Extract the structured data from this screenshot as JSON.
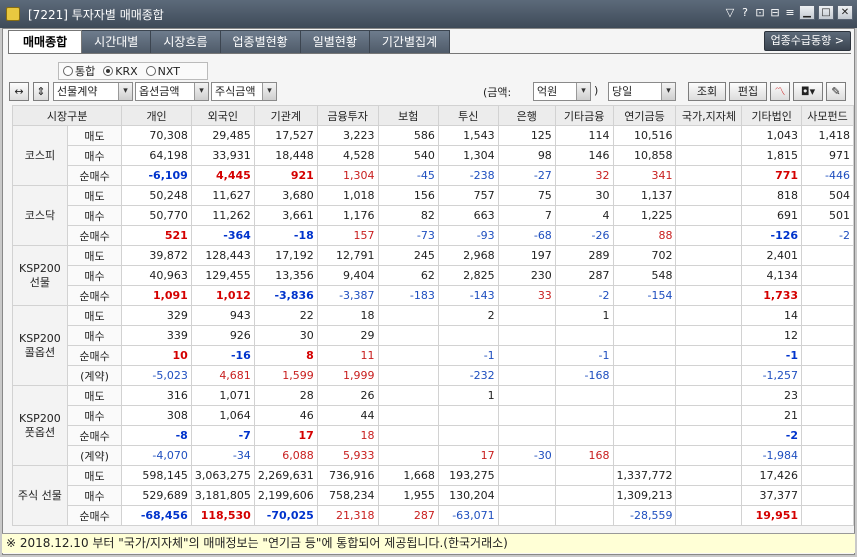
{
  "window": {
    "title": "[7221] 투자자별 매매종합"
  },
  "tabs": [
    "매매종합",
    "시간대별",
    "시장흐름",
    "업종별현황",
    "일별현황",
    "기간별집계"
  ],
  "side_button": "업종수급동향 >",
  "market_radios": [
    "통합",
    "KRX",
    "NXT"
  ],
  "market_selected": "KRX",
  "controls": {
    "product": "선물계약",
    "amount_type": "옵션금액",
    "stock_amount": "주식금액",
    "amount_label_open": "(금액:",
    "unit": "억원",
    "amount_label_close": ")",
    "period": "당일",
    "query_btn": "조회",
    "edit_btn": "편집"
  },
  "headers": [
    "시장구분",
    "",
    "개인",
    "외국인",
    "기관계",
    "금융투자",
    "보험",
    "투신",
    "은행",
    "기타금융",
    "연기금등",
    "국가,지자체",
    "기타법인",
    "사모펀드"
  ],
  "sections": [
    {
      "market": "코스피",
      "rows": [
        {
          "label": "매도",
          "v": [
            "70,308",
            "29,485",
            "17,527",
            "3,223",
            "586",
            "1,543",
            "125",
            "114",
            "10,516",
            "",
            "1,043",
            "1,418"
          ]
        },
        {
          "label": "매수",
          "v": [
            "64,198",
            "33,931",
            "18,448",
            "4,528",
            "540",
            "1,304",
            "98",
            "146",
            "10,858",
            "",
            "1,815",
            "971"
          ]
        },
        {
          "label": "순매수",
          "v": [
            "-6,109",
            "4,445",
            "921",
            "1,304",
            "-45",
            "-238",
            "-27",
            "32",
            "341",
            "",
            "771",
            "-446"
          ]
        }
      ]
    },
    {
      "market": "코스닥",
      "rows": [
        {
          "label": "매도",
          "v": [
            "50,248",
            "11,627",
            "3,680",
            "1,018",
            "156",
            "757",
            "75",
            "30",
            "1,137",
            "",
            "818",
            "504"
          ]
        },
        {
          "label": "매수",
          "v": [
            "50,770",
            "11,262",
            "3,661",
            "1,176",
            "82",
            "663",
            "7",
            "4",
            "1,225",
            "",
            "691",
            "501"
          ]
        },
        {
          "label": "순매수",
          "v": [
            "521",
            "-364",
            "-18",
            "157",
            "-73",
            "-93",
            "-68",
            "-26",
            "88",
            "",
            "-126",
            "-2"
          ]
        }
      ]
    },
    {
      "market": "KSP200 선물",
      "rows": [
        {
          "label": "매도",
          "v": [
            "39,872",
            "128,443",
            "17,192",
            "12,791",
            "245",
            "2,968",
            "197",
            "289",
            "702",
            "",
            "2,401",
            ""
          ]
        },
        {
          "label": "매수",
          "v": [
            "40,963",
            "129,455",
            "13,356",
            "9,404",
            "62",
            "2,825",
            "230",
            "287",
            "548",
            "",
            "4,134",
            ""
          ]
        },
        {
          "label": "순매수",
          "v": [
            "1,091",
            "1,012",
            "-3,836",
            "-3,387",
            "-183",
            "-143",
            "33",
            "-2",
            "-154",
            "",
            "1,733",
            ""
          ]
        }
      ]
    },
    {
      "market": "KSP200 콜옵션",
      "rows": [
        {
          "label": "매도",
          "v": [
            "329",
            "943",
            "22",
            "18",
            "",
            "2",
            "",
            "1",
            "",
            "",
            "14",
            ""
          ]
        },
        {
          "label": "매수",
          "v": [
            "339",
            "926",
            "30",
            "29",
            "",
            "",
            "",
            "",
            "",
            "",
            "12",
            ""
          ]
        },
        {
          "label": "순매수",
          "v": [
            "10",
            "-16",
            "8",
            "11",
            "",
            "-1",
            "",
            "-1",
            "",
            "",
            "-1",
            ""
          ]
        },
        {
          "label": "(계약)",
          "v": [
            "-5,023",
            "4,681",
            "1,599",
            "1,999",
            "",
            "-232",
            "",
            "-168",
            "",
            "",
            "-1,257",
            ""
          ]
        }
      ]
    },
    {
      "market": "KSP200 풋옵션",
      "rows": [
        {
          "label": "매도",
          "v": [
            "316",
            "1,071",
            "28",
            "26",
            "",
            "1",
            "",
            "",
            "",
            "",
            "23",
            ""
          ]
        },
        {
          "label": "매수",
          "v": [
            "308",
            "1,064",
            "46",
            "44",
            "",
            "",
            "",
            "",
            "",
            "",
            "21",
            ""
          ]
        },
        {
          "label": "순매수",
          "v": [
            "-8",
            "-7",
            "17",
            "18",
            "",
            "",
            "",
            "",
            "",
            "",
            "-2",
            ""
          ]
        },
        {
          "label": "(계약)",
          "v": [
            "-4,070",
            "-34",
            "6,088",
            "5,933",
            "",
            "17",
            "-30",
            "168",
            "",
            "",
            "-1,984",
            ""
          ]
        }
      ]
    },
    {
      "market": "주식 선물",
      "rows": [
        {
          "label": "매도",
          "v": [
            "598,145",
            "3,063,275",
            "2,269,631",
            "736,916",
            "1,668",
            "193,275",
            "",
            "",
            "1,337,772",
            "",
            "17,426",
            ""
          ]
        },
        {
          "label": "매수",
          "v": [
            "529,689",
            "3,181,805",
            "2,199,606",
            "758,234",
            "1,955",
            "130,204",
            "",
            "",
            "1,309,213",
            "",
            "37,377",
            ""
          ]
        },
        {
          "label": "순매수",
          "v": [
            "-68,456",
            "118,530",
            "-70,025",
            "21,318",
            "287",
            "-63,071",
            "",
            "",
            "-28,559",
            "",
            "19,951",
            ""
          ]
        }
      ]
    }
  ],
  "footer": "※ 2018.12.10 부터 \"국가/지자체\"의 매매정보는 \"연기금 등\"에 통합되어 제공됩니다.(한국거래소)",
  "colors": {
    "positive": "#c81e1e",
    "negative": "#1f4fbf",
    "titlebar": "#4a5666"
  }
}
